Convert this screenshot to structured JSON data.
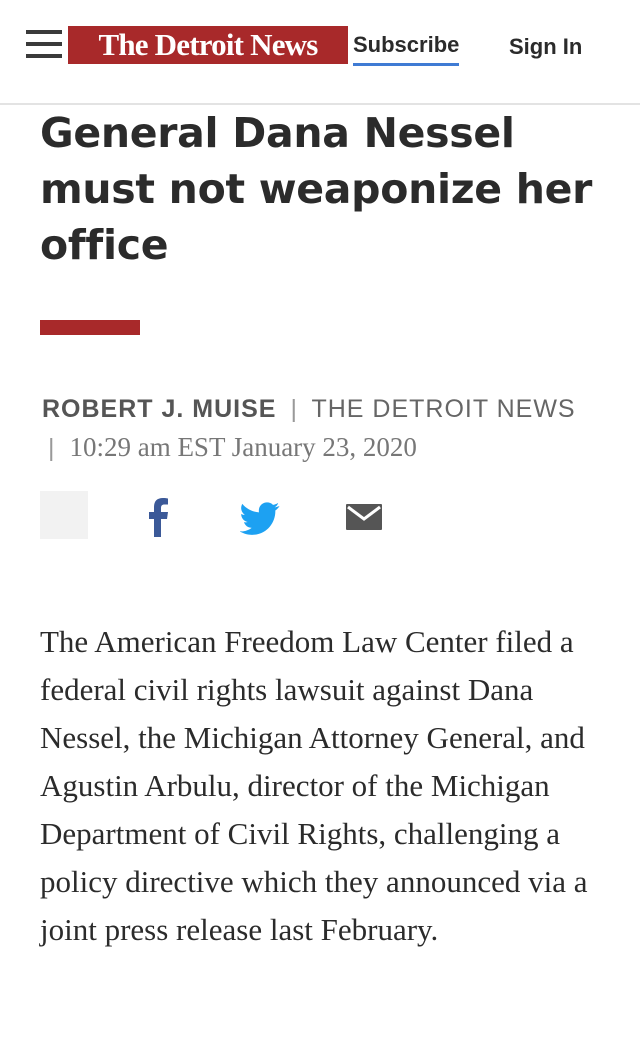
{
  "header": {
    "logo_text": "The Detroit News",
    "subscribe_label": "Subscribe",
    "signin_label": "Sign In",
    "menu_icon": "hamburger-menu-icon"
  },
  "article": {
    "headline": "General Dana Nessel must not weaponize her office",
    "author": "ROBERT J. MUISE",
    "publication": "THE DETROIT NEWS",
    "timestamp": "10:29 am EST January 23, 2020",
    "body": "The American Freedom Law Center filed a federal civil rights lawsuit against Dana Nessel, the Michigan Attorney General, and Agustin Arbulu, director of the Michigan Department of Civil Rights, challenging a policy directive which they announced via a joint press release last February."
  },
  "share": {
    "icons": [
      "facebook-icon",
      "twitter-icon",
      "email-icon"
    ]
  },
  "colors": {
    "brand_red": "#a8292a",
    "subscribe_underline": "#3f7bd4",
    "facebook_blue": "#3b5998",
    "twitter_blue": "#1da1f2",
    "email_gray": "#555555"
  }
}
